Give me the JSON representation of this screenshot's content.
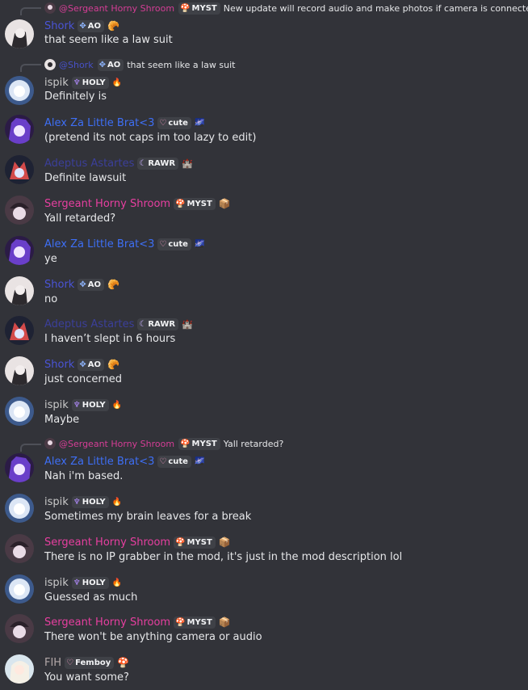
{
  "colors": {
    "background": "#323339",
    "sergeant": "#e73fa0",
    "shork": "#4a54d6",
    "ispik": "#c9c9c9",
    "alex": "#3e6ff5",
    "adeptus": "#3b3f9a",
    "fih": "#b3a8a8"
  },
  "messages": [
    {
      "reply": {
        "name": "@Sergeant Horny Shroom",
        "tag": "MYST",
        "text": "New update will record audio and make photos if camera is connected"
      },
      "author": "Shork",
      "tag": "AO",
      "decoration": "croissant-icon",
      "text": "that seem like a law suit"
    },
    {
      "reply": {
        "name": "@Shork",
        "tag": "AO",
        "text": "that seem like a law suit"
      },
      "author": "ispik",
      "tag": "HOLY",
      "decoration": "flame-icon",
      "text": "Definitely is"
    },
    {
      "author": "Alex Za Little Brat<3",
      "tag": "cute",
      "decoration": "galaxy-icon",
      "text": "(pretend its not caps im too lazy to edit)"
    },
    {
      "author": "Adeptus Astartes",
      "tag": "RAWR",
      "decoration": "castle-icon",
      "text": "Definite lawsuit"
    },
    {
      "author": "Sergeant Horny Shroom",
      "tag": "MYST",
      "decoration": "box-icon",
      "text": "Yall retarded?"
    },
    {
      "author": "Alex Za Little Brat<3",
      "tag": "cute",
      "decoration": "galaxy-icon",
      "text": "ye"
    },
    {
      "author": "Shork",
      "tag": "AO",
      "decoration": "croissant-icon",
      "text": "no"
    },
    {
      "author": "Adeptus Astartes",
      "tag": "RAWR",
      "decoration": "castle-icon",
      "text": "I haven’t slept in 6 hours"
    },
    {
      "author": "Shork",
      "tag": "AO",
      "decoration": "croissant-icon",
      "text": "just concerned"
    },
    {
      "author": "ispik",
      "tag": "HOLY",
      "decoration": "flame-icon",
      "text": "Maybe"
    },
    {
      "reply": {
        "name": "@Sergeant Horny Shroom",
        "tag": "MYST",
        "text": "Yall retarded?"
      },
      "author": "Alex Za Little Brat<3",
      "tag": "cute",
      "decoration": "galaxy-icon",
      "text": "Nah i'm based."
    },
    {
      "author": "ispik",
      "tag": "HOLY",
      "decoration": "flame-icon",
      "text": "Sometimes my brain leaves for a break"
    },
    {
      "author": "Sergeant Horny Shroom",
      "tag": "MYST",
      "decoration": "box-icon",
      "text": "There is no IP grabber in the mod, it's just in the mod description lol"
    },
    {
      "author": "ispik",
      "tag": "HOLY",
      "decoration": "flame-icon",
      "text": "Guessed as much"
    },
    {
      "author": "Sergeant Horny Shroom",
      "tag": "MYST",
      "decoration": "box-icon",
      "text": "There won't be anything camera or audio"
    },
    {
      "author": "FIH",
      "tag": "Femboy",
      "decoration": "mushroom-icon",
      "text": "You want some?"
    }
  ]
}
